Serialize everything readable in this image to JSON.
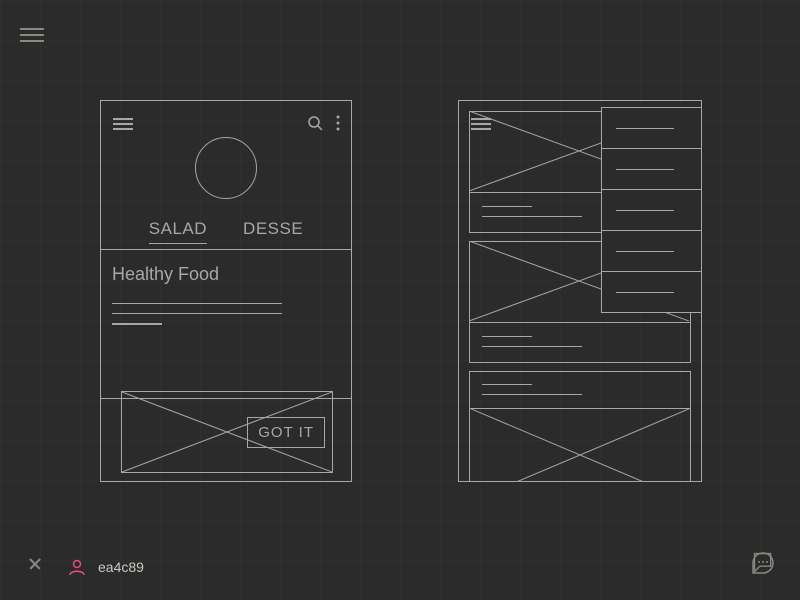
{
  "app": {
    "user_color_hex": "ea4c89",
    "accent": "#ea4c89"
  },
  "artboard1": {
    "tabs": [
      "SALAD",
      "DESSE"
    ],
    "card_title": "Healthy Food",
    "dismiss_button": "GOT IT"
  },
  "artboard2": {
    "menu_items": [
      "",
      "",
      "",
      "",
      ""
    ]
  }
}
